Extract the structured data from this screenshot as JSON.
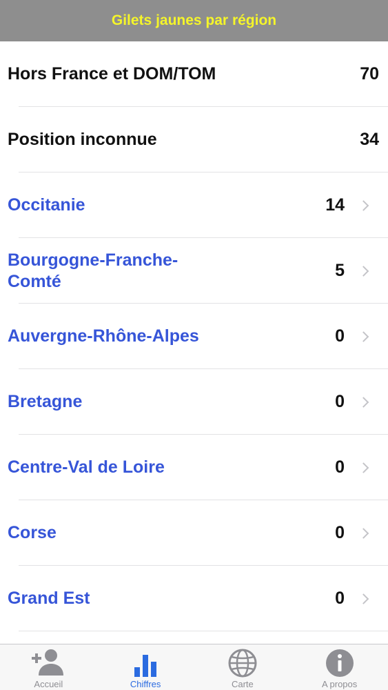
{
  "header": {
    "title": "Gilets jaunes par région"
  },
  "rows": [
    {
      "label": "Hors France et DOM/TOM",
      "count": "70"
    },
    {
      "label": "Position inconnue",
      "count": "34"
    },
    {
      "label": "Occitanie",
      "count": "14"
    },
    {
      "label": "Bourgogne-Franche-Comté",
      "count": "5"
    },
    {
      "label": "Auvergne-Rhône-Alpes",
      "count": "0"
    },
    {
      "label": "Bretagne",
      "count": "0"
    },
    {
      "label": "Centre-Val de Loire",
      "count": "0"
    },
    {
      "label": "Corse",
      "count": "0"
    },
    {
      "label": "Grand Est",
      "count": "0"
    }
  ],
  "tabbar": {
    "tabs": [
      {
        "label": "Accueil",
        "icon": "add-person-icon",
        "active": false
      },
      {
        "label": "Chiffres",
        "icon": "bar-chart-icon",
        "active": true
      },
      {
        "label": "Carte",
        "icon": "globe-icon",
        "active": false
      },
      {
        "label": "A propos",
        "icon": "info-icon",
        "active": false
      }
    ]
  },
  "colors": {
    "header_bg": "#8e8e8e",
    "header_title": "#f5f52a",
    "link_text": "#3655d8",
    "active_tab": "#2b6be0",
    "inactive_tab": "#8e8e93"
  }
}
